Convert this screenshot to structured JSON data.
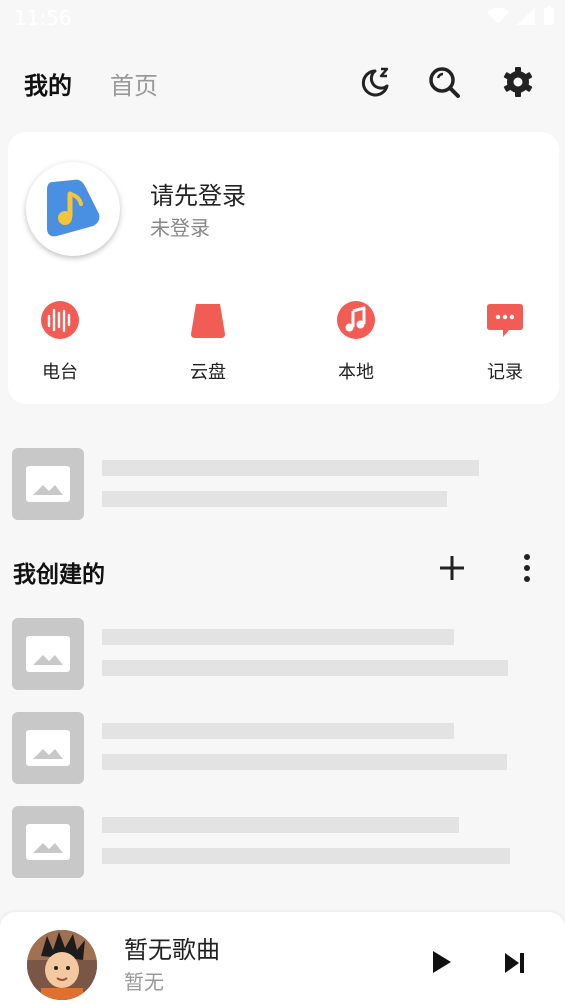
{
  "status_bar": {
    "time": "11:56"
  },
  "header": {
    "tabs": [
      {
        "label": "我的",
        "active": true
      },
      {
        "label": "首页",
        "active": false
      }
    ],
    "icons": [
      "sleep-timer-icon",
      "search-icon",
      "settings-icon"
    ]
  },
  "user_card": {
    "title": "请先登录",
    "status": "未登录",
    "quick_actions": [
      {
        "label": "电台",
        "icon": "radio-icon"
      },
      {
        "label": "云盘",
        "icon": "cloud-disk-icon"
      },
      {
        "label": "本地",
        "icon": "music-note-icon"
      },
      {
        "label": "记录",
        "icon": "history-icon"
      }
    ]
  },
  "section": {
    "title": "我创建的",
    "add_icon": "plus-icon",
    "more_icon": "more-vertical-icon"
  },
  "player": {
    "song": "暂无歌曲",
    "artist": "暂无",
    "play_icon": "play-icon",
    "next_icon": "skip-next-icon"
  },
  "colors": {
    "accent": "#f15d55",
    "brand_blue": "#4a90e2",
    "brand_yellow": "#f5c43a",
    "skeleton": "#e3e3e3",
    "thumb": "#c8c8c8",
    "background": "#f7f7f7"
  }
}
